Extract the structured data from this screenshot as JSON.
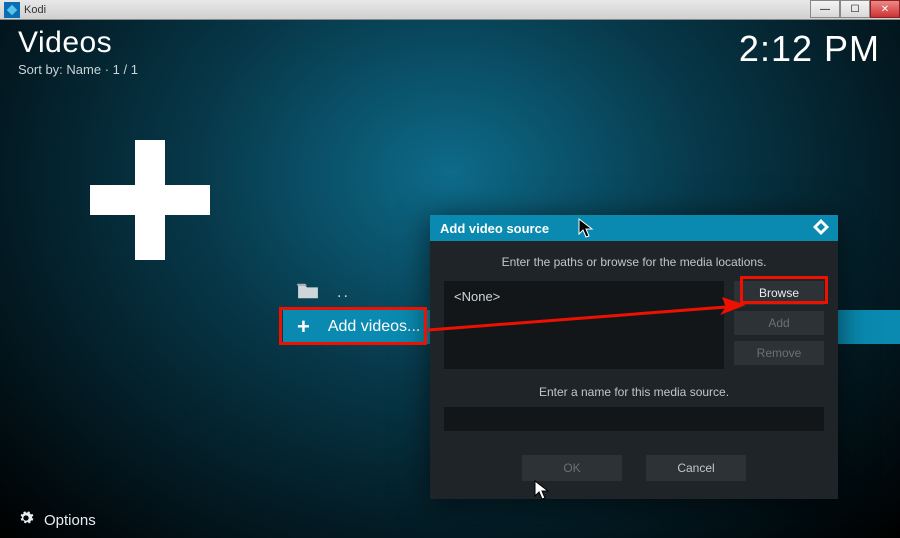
{
  "window": {
    "title": "Kodi"
  },
  "header": {
    "title": "Videos",
    "sort_label": "Sort by: Name",
    "page_label": "1 / 1"
  },
  "clock": "2:12 PM",
  "list": {
    "up_label": "..",
    "add_label": "Add videos..."
  },
  "dialog": {
    "title": "Add video source",
    "instruction": "Enter the paths or browse for the media locations.",
    "path_value": "<None>",
    "browse": "Browse",
    "add": "Add",
    "remove": "Remove",
    "name_label": "Enter a name for this media source.",
    "name_value": "",
    "ok": "OK",
    "cancel": "Cancel"
  },
  "footer": {
    "options": "Options"
  }
}
